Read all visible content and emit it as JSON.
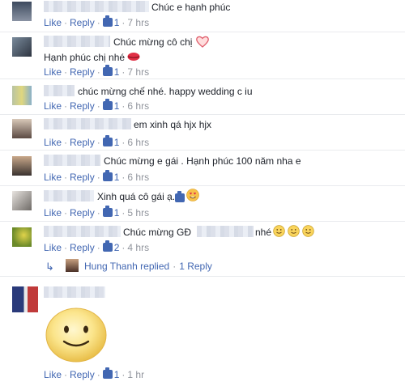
{
  "comments": [
    {
      "text": "Chúc e hạnh phúc",
      "likes": "1",
      "time": "7 hrs"
    },
    {
      "text": "Chúc mừng cô chị",
      "text2": "Hạnh phúc chị nhé",
      "likes": "1",
      "time": "7 hrs"
    },
    {
      "text": "chúc mừng chế nhé. happy wedding c iu",
      "likes": "1",
      "time": "6 hrs"
    },
    {
      "text": "em xinh qá hjx hjx",
      "likes": "1",
      "time": "6 hrs"
    },
    {
      "text": "Chúc mừng e gái . Hạnh phúc 100 năm nha e",
      "likes": "1",
      "time": "6 hrs"
    },
    {
      "text": "Xinh quá cô gái ạ..",
      "likes": "1",
      "time": "5 hrs"
    },
    {
      "text": "Chúc mừng GĐ",
      "text_after": "nhé",
      "likes": "2",
      "time": "4 hrs"
    },
    {
      "text": "",
      "likes": "1",
      "time": "1 hr"
    }
  ],
  "labels": {
    "like": "Like",
    "reply": "Reply",
    "dot": "·"
  },
  "reply_summary": {
    "name": "Hung Thanh replied",
    "count": "1 Reply",
    "sep": "·"
  },
  "colors": {
    "link": "#4267b2",
    "meta": "#90949c",
    "divider": "#e9ebee"
  },
  "icons": [
    "thumb-up-icon",
    "heart-icon",
    "kiss-lips-icon",
    "smiley-icon",
    "reply-arrow-icon",
    "heart-eyes-icon"
  ]
}
